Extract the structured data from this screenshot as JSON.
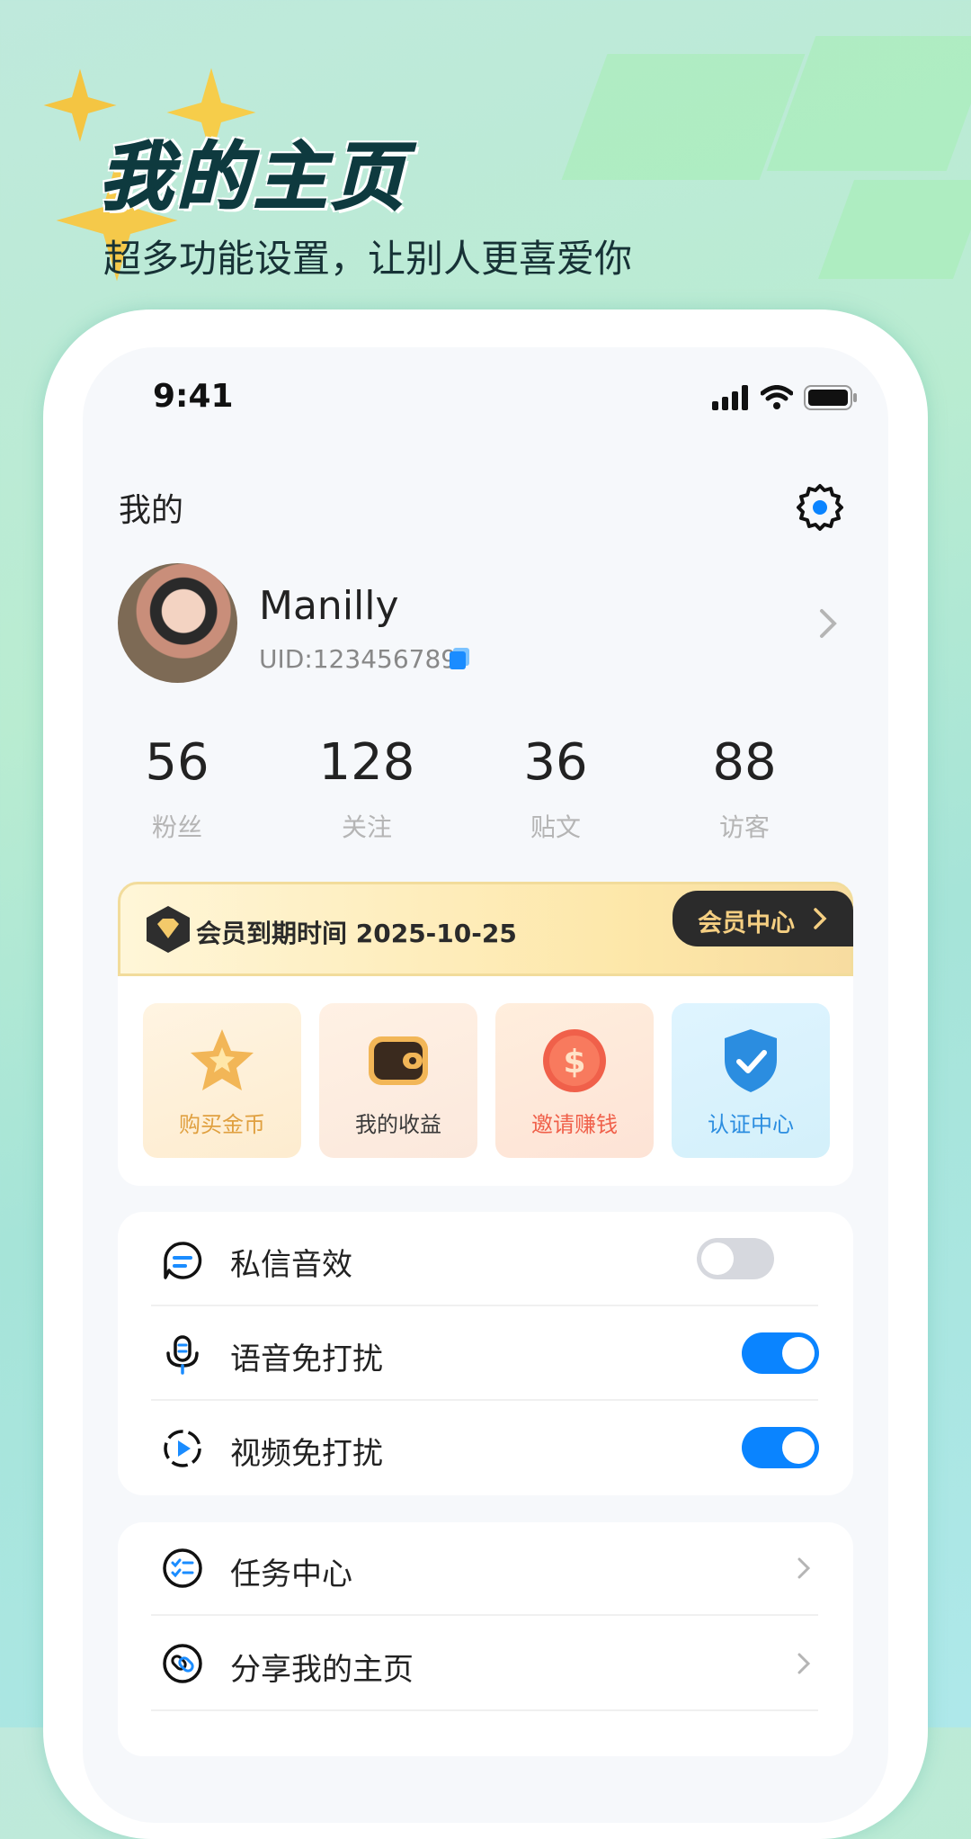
{
  "hero": {
    "title": "我的主页",
    "subtitle": "超多功能设置，让别人更喜爱你"
  },
  "status_bar": {
    "time": "9:41"
  },
  "header": {
    "title": "我的",
    "settings_icon": "gear-icon"
  },
  "profile": {
    "name": "Manilly",
    "uid": "UID:123456789"
  },
  "stats": [
    {
      "value": "56",
      "label": "粉丝"
    },
    {
      "value": "128",
      "label": "关注"
    },
    {
      "value": "36",
      "label": "贴文"
    },
    {
      "value": "88",
      "label": "访客"
    }
  ],
  "membership": {
    "text": "会员到期时间 2025-10-25",
    "button": "会员中心"
  },
  "quick_actions": [
    {
      "label": "购买金币",
      "icon": "star-coin-icon",
      "color": "#e0a040"
    },
    {
      "label": "我的收益",
      "icon": "wallet-icon",
      "color": "#3a3a3a"
    },
    {
      "label": "邀请赚钱",
      "icon": "dollar-coin-icon",
      "color": "#f0604a"
    },
    {
      "label": "认证中心",
      "icon": "shield-check-icon",
      "color": "#2b8de0"
    }
  ],
  "toggles": [
    {
      "label": "私信音效",
      "icon": "message-icon",
      "on": false
    },
    {
      "label": "语音免打扰",
      "icon": "microphone-icon",
      "on": true
    },
    {
      "label": "视频免打扰",
      "icon": "video-play-icon",
      "on": true
    }
  ],
  "menu": [
    {
      "label": "任务中心",
      "icon": "task-list-icon"
    },
    {
      "label": "分享我的主页",
      "icon": "link-icon"
    }
  ],
  "colors": {
    "accent": "#0a84ff",
    "toggle_off": "#d6d8de",
    "member_btn_bg": "#2b2b2b",
    "member_btn_text": "#f5cf82"
  }
}
